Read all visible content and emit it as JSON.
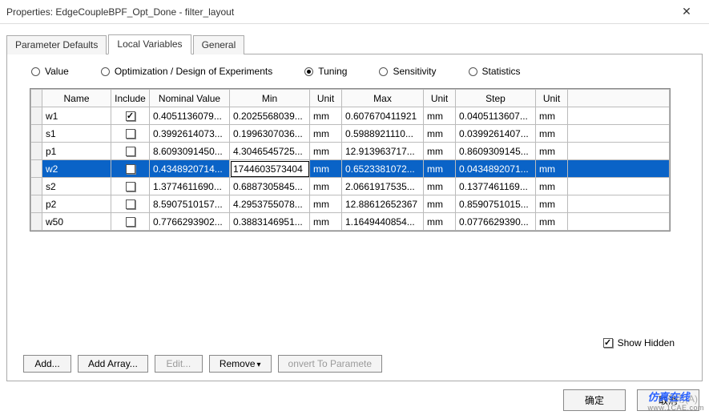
{
  "window": {
    "title": "Properties: EdgeCoupleBPF_Opt_Done - filter_layout",
    "close_glyph": "✕"
  },
  "tabs": [
    {
      "label": "Parameter Defaults",
      "active": false
    },
    {
      "label": "Local Variables",
      "active": true
    },
    {
      "label": "General",
      "active": false
    }
  ],
  "radios": [
    {
      "label": "Value",
      "selected": false
    },
    {
      "label": "Optimization / Design of Experiments",
      "selected": false
    },
    {
      "label": "Tuning",
      "selected": true
    },
    {
      "label": "Sensitivity",
      "selected": false
    },
    {
      "label": "Statistics",
      "selected": false
    }
  ],
  "grid": {
    "headers": {
      "name": "Name",
      "include": "Include",
      "nominal": "Nominal Value",
      "min": "Min",
      "unit1": "Unit",
      "max": "Max",
      "unit2": "Unit",
      "step": "Step",
      "unit3": "Unit"
    },
    "rows": [
      {
        "name": "w1",
        "include": true,
        "nominal": "0.4051136079...",
        "min": "0.2025568039...",
        "u1": "mm",
        "max": "0.607670411921",
        "u2": "mm",
        "step": "0.0405113607...",
        "u3": "mm",
        "selected": false
      },
      {
        "name": "s1",
        "include": false,
        "nominal": "0.3992614073...",
        "min": "0.1996307036...",
        "u1": "mm",
        "max": "0.5988921110...",
        "u2": "mm",
        "step": "0.0399261407...",
        "u3": "mm",
        "selected": false
      },
      {
        "name": "p1",
        "include": false,
        "nominal": "8.6093091450...",
        "min": "4.3046545725...",
        "u1": "mm",
        "max": "12.913963717...",
        "u2": "mm",
        "step": "0.8609309145...",
        "u3": "mm",
        "selected": false
      },
      {
        "name": "w2",
        "include": true,
        "nominal": "0.4348920714...",
        "min": "1744603573404",
        "u1": "mm",
        "max": "0.6523381072...",
        "u2": "mm",
        "step": "0.0434892071...",
        "u3": "mm",
        "selected": true,
        "editing": "min"
      },
      {
        "name": "s2",
        "include": false,
        "nominal": "1.3774611690...",
        "min": "0.6887305845...",
        "u1": "mm",
        "max": "2.0661917535...",
        "u2": "mm",
        "step": "0.1377461169...",
        "u3": "mm",
        "selected": false
      },
      {
        "name": "p2",
        "include": false,
        "nominal": "8.5907510157...",
        "min": "4.2953755078...",
        "u1": "mm",
        "max": "12.88612652367",
        "u2": "mm",
        "step": "0.8590751015...",
        "u3": "mm",
        "selected": false
      },
      {
        "name": "w50",
        "include": false,
        "nominal": "0.7766293902...",
        "min": "0.3883146951...",
        "u1": "mm",
        "max": "1.1649440854...",
        "u2": "mm",
        "step": "0.0776629390...",
        "u3": "mm",
        "selected": false
      }
    ]
  },
  "showhidden": {
    "label": "Show Hidden",
    "checked": true
  },
  "buttons": {
    "add": "Add...",
    "add_array": "Add Array...",
    "edit": "Edit...",
    "remove": "Remove",
    "convert": "onvert To Paramete"
  },
  "footer": {
    "ok": "确定",
    "cancel": "取消",
    "apply": "应用(A)"
  },
  "watermark": {
    "brand": "仿真在线",
    "url": "www.1CAE.com"
  }
}
